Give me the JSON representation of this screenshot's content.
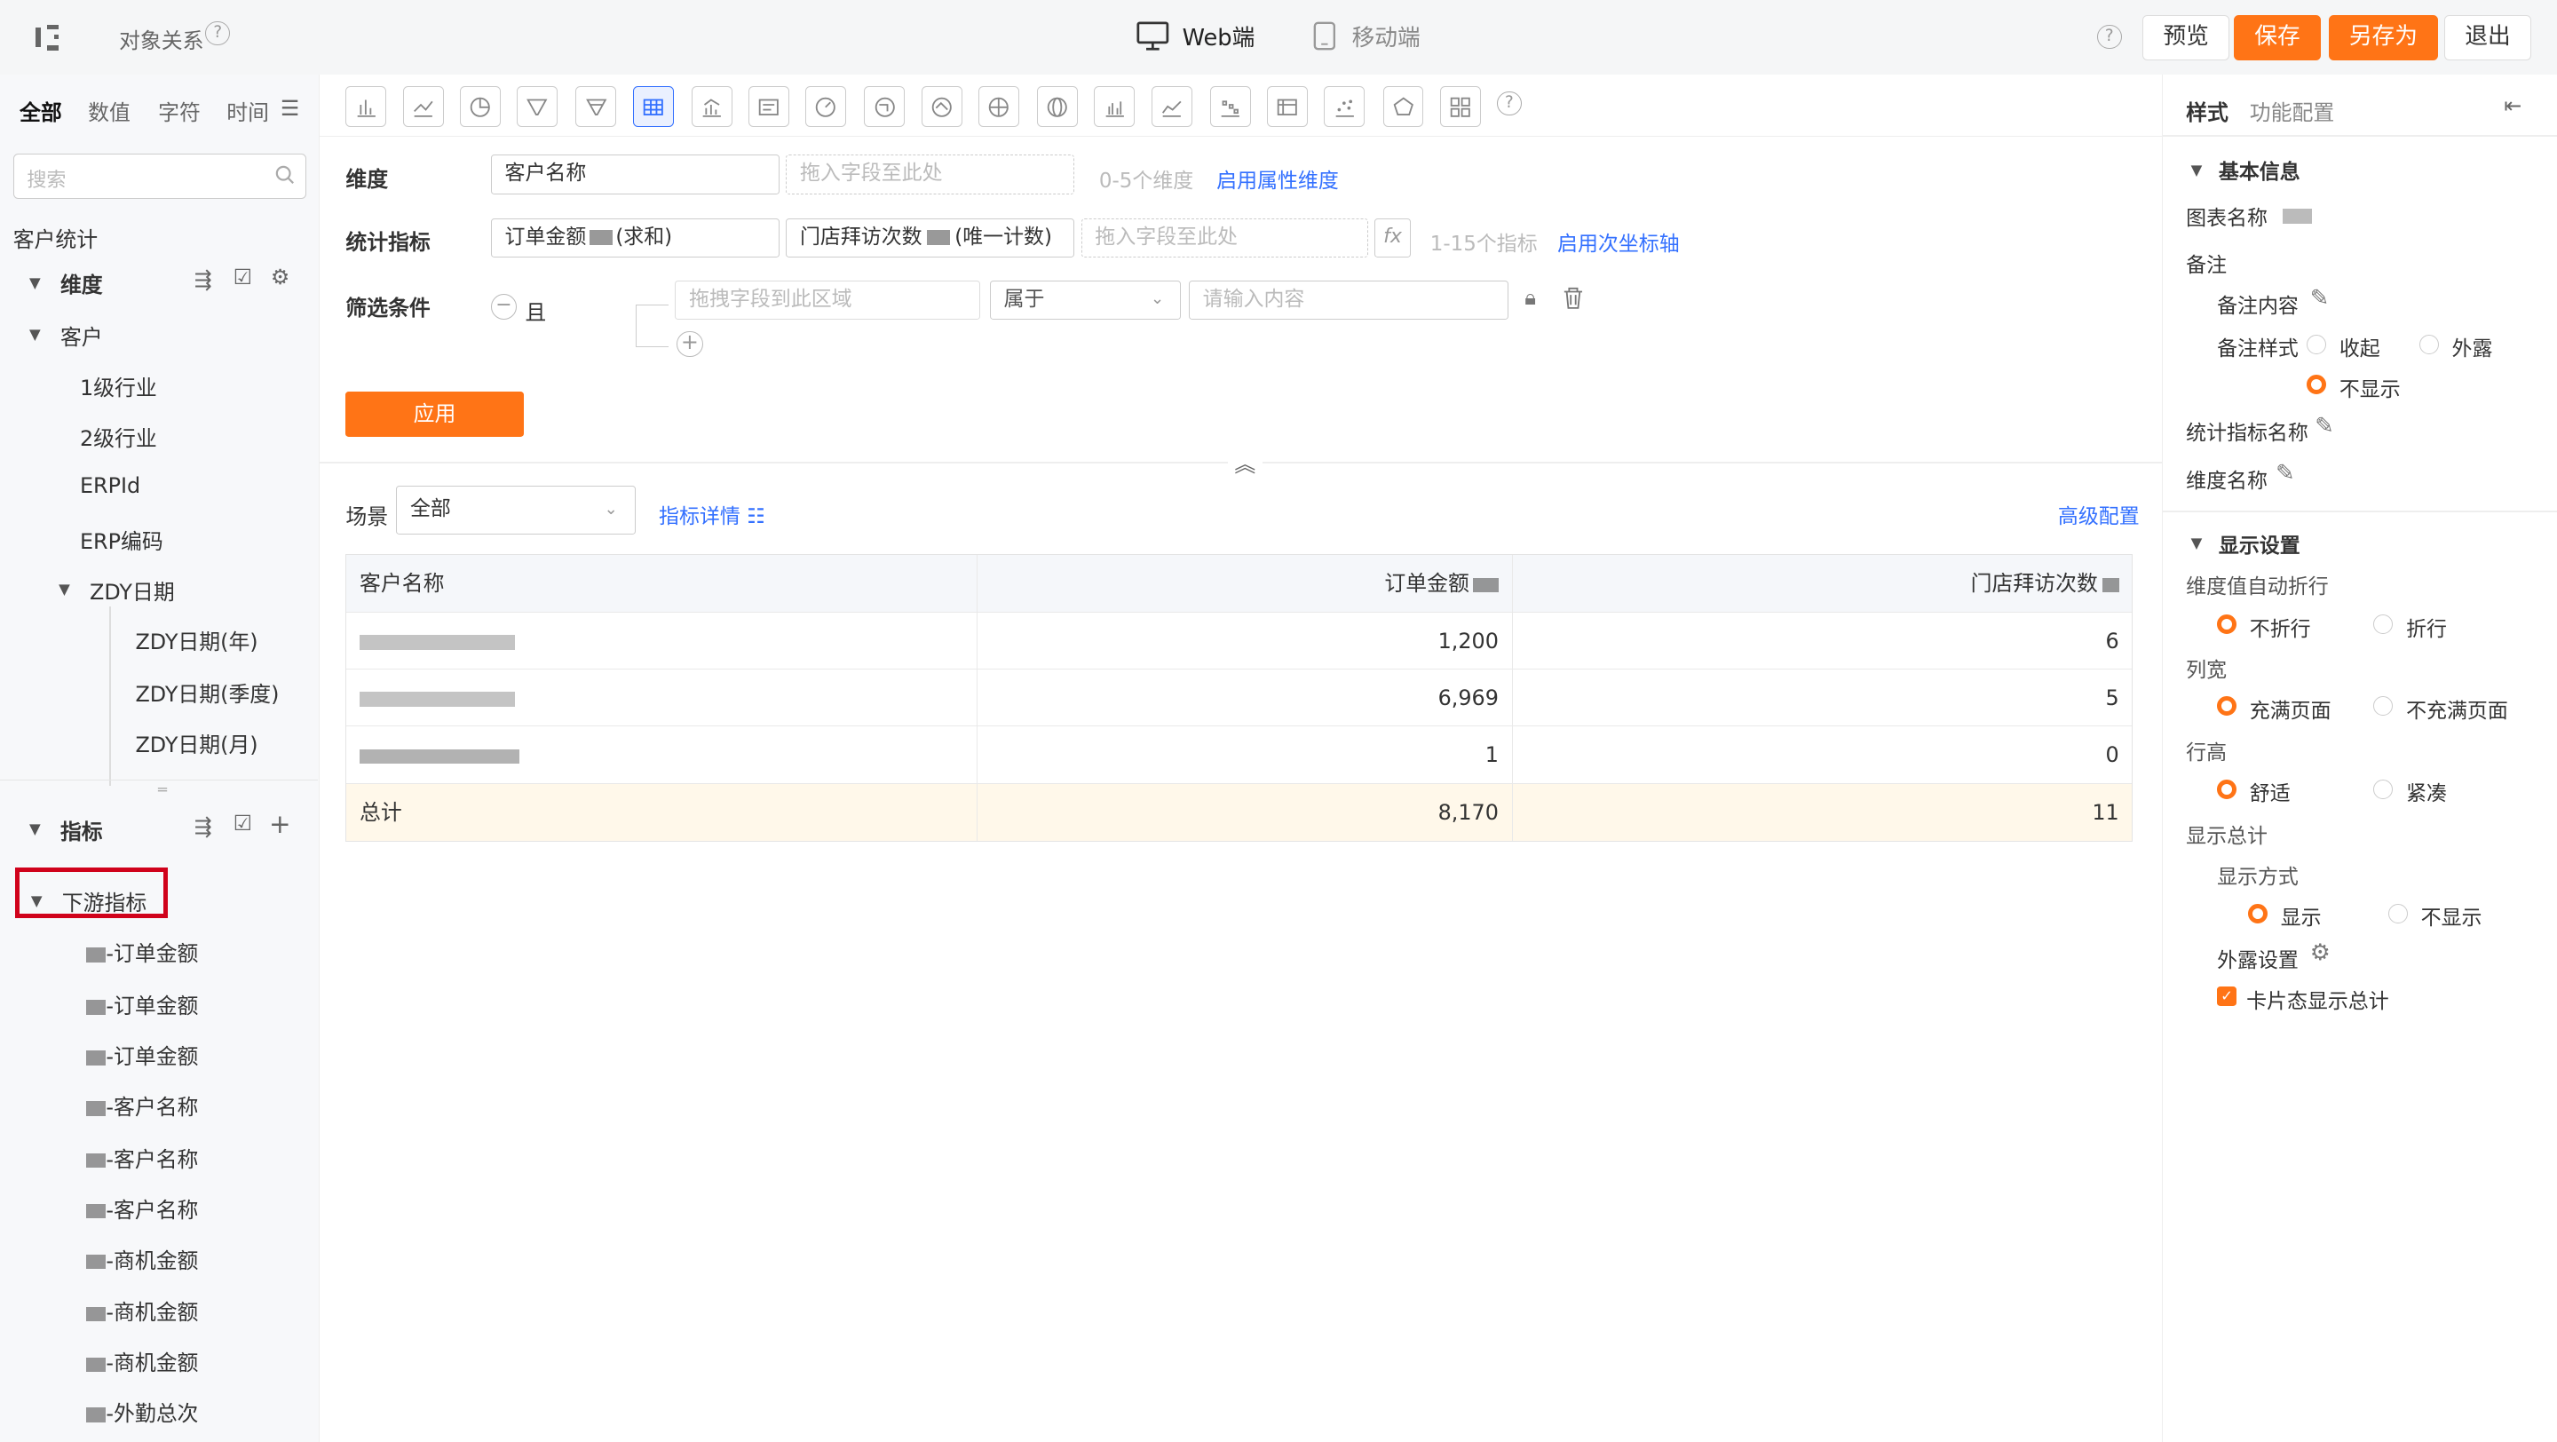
{
  "header": {
    "object_relation": "对象关系",
    "web_tab": "Web端",
    "mobile_tab": "移动端",
    "preview": "预览",
    "save": "保存",
    "save_as": "另存为",
    "exit": "退出"
  },
  "left": {
    "tabs": [
      "全部",
      "数值",
      "字符",
      "时间"
    ],
    "search_placeholder": "搜索",
    "section_title": "客户统计",
    "dimension_title": "维度",
    "customer": "客户",
    "fields": [
      "1级行业",
      "2级行业",
      "ERPId",
      "ERP编码"
    ],
    "zdy_group": "ZDY日期",
    "zdy_items": [
      "ZDY日期(年)",
      "ZDY日期(季度)",
      "ZDY日期(月)"
    ],
    "metric_title": "指标",
    "downstream_title": "下游指标",
    "downstream_items": [
      "-订单金额",
      "-订单金额",
      "-订单金额",
      "-客户名称",
      "-客户名称",
      "-客户名称",
      "-商机金额",
      "-商机金额",
      "-商机金额",
      "-外勤总次"
    ]
  },
  "config": {
    "dimension_label": "维度",
    "dimension_chip": "客户名称",
    "drop_hint": "拖入字段至此处",
    "dimension_range": "0-5个维度",
    "enable_attr_dim": "启用属性维度",
    "metric_label": "统计指标",
    "metric_chip_1_name": "订单金额",
    "metric_chip_1_agg": "(求和)",
    "metric_chip_2_name": "门店拜访次数",
    "metric_chip_2_agg": "(唯一计数)",
    "metric_range": "1-15个指标",
    "enable_secondary_axis": "启用次坐标轴",
    "filter_label": "筛选条件",
    "filter_and": "且",
    "filter_field_placeholder": "拖拽字段到此区域",
    "filter_operator": "属于",
    "filter_value_placeholder": "请输入内容",
    "apply": "应用"
  },
  "scene": {
    "label": "场景",
    "value": "全部",
    "metric_detail": "指标详情",
    "advanced": "高级配置"
  },
  "table": {
    "columns": [
      "客户名称",
      "订单金额",
      "门店拜访次数"
    ],
    "rows": [
      [
        "",
        "1,200",
        "6"
      ],
      [
        "",
        "6,969",
        "5"
      ],
      [
        "",
        "1",
        "0"
      ]
    ],
    "total": [
      "总计",
      "8,170",
      "11"
    ]
  },
  "right": {
    "tab_style": "样式",
    "tab_function": "功能配置",
    "basic_info": "基本信息",
    "chart_name": "图表名称",
    "remark": "备注",
    "remark_content": "备注内容",
    "remark_style": "备注样式",
    "remark_opts": [
      "收起",
      "外露",
      "不显示"
    ],
    "metric_name": "统计指标名称",
    "dimension_name": "维度名称",
    "display_settings": "显示设置",
    "auto_wrap": "维度值自动折行",
    "wrap_opts": [
      "不折行",
      "折行"
    ],
    "col_width": "列宽",
    "width_opts": [
      "充满页面",
      "不充满页面"
    ],
    "row_height": "行高",
    "height_opts": [
      "舒适",
      "紧凑"
    ],
    "show_total": "显示总计",
    "display_mode": "显示方式",
    "display_opts": [
      "显示",
      "不显示"
    ],
    "expose_settings": "外露设置",
    "card_total": "卡片态显示总计"
  },
  "colors": {
    "accent": "#ff7416",
    "link": "#3370ff",
    "highlight": "#d0021b"
  }
}
